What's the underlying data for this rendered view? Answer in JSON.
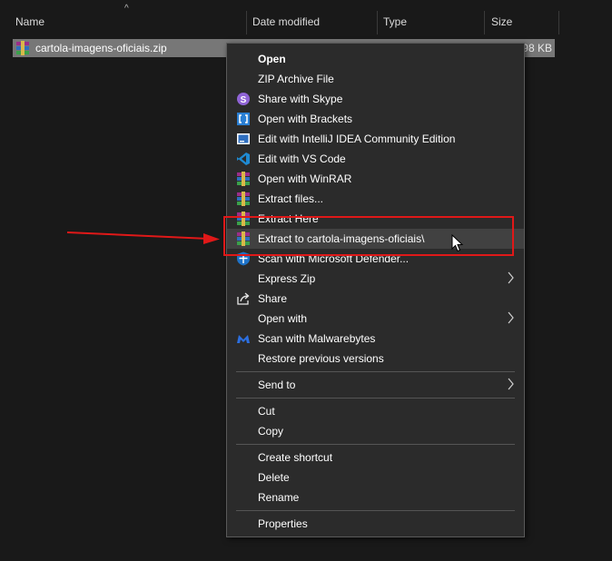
{
  "columns": {
    "name": "Name",
    "date_modified": "Date modified",
    "type": "Type",
    "size": "Size"
  },
  "file": {
    "name": "cartola-imagens-oficiais.zip",
    "size": "98 KB",
    "icon": "winrar-archive-icon"
  },
  "menu": {
    "open": "Open",
    "zip_archive_file": "ZIP Archive File",
    "share_skype": "Share with Skype",
    "open_brackets": "Open with Brackets",
    "edit_intellij": "Edit with IntelliJ IDEA Community Edition",
    "edit_vscode": "Edit with VS Code",
    "open_winrar": "Open with WinRAR",
    "extract_files": "Extract files...",
    "extract_here": "Extract Here",
    "extract_to": "Extract to cartola-imagens-oficiais\\",
    "scan_defender": "Scan with Microsoft Defender...",
    "express_zip": "Express Zip",
    "share": "Share",
    "open_with": "Open with",
    "scan_malwarebytes": "Scan with Malwarebytes",
    "restore_versions": "Restore previous versions",
    "send_to": "Send to",
    "cut": "Cut",
    "copy": "Copy",
    "create_shortcut": "Create shortcut",
    "delete": "Delete",
    "rename": "Rename",
    "properties": "Properties"
  },
  "colors": {
    "menu_bg": "#2b2b2b",
    "hover": "#414141",
    "highlight_red": "#e01818",
    "selected_row": "#777777"
  }
}
